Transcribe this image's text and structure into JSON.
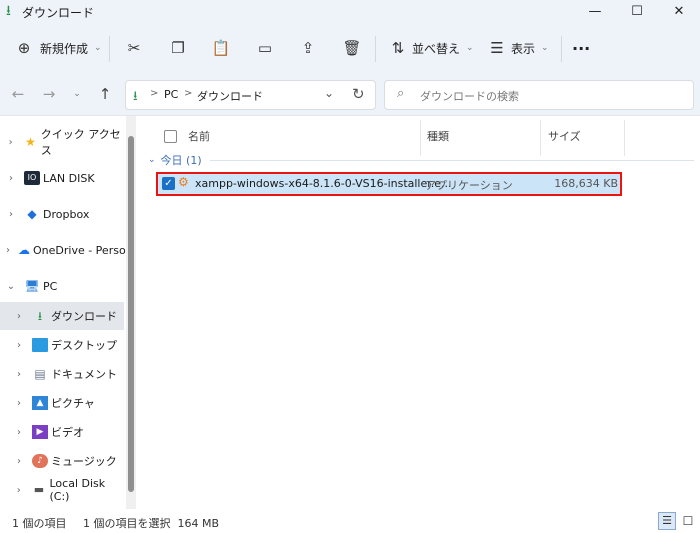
{
  "window": {
    "title": "ダウンロード",
    "minimize_glyph": "—",
    "maximize_glyph": "☐",
    "close_glyph": "✕"
  },
  "toolbar": {
    "new_label": "新規作成",
    "sort_label": "並べ替え",
    "view_label": "表示",
    "more_glyph": "···"
  },
  "address": {
    "segments": [
      "PC",
      "ダウンロード"
    ],
    "separator": ">"
  },
  "search": {
    "placeholder": "ダウンロードの検索"
  },
  "sidebar": {
    "items": [
      {
        "label": "クイック アクセス",
        "icon": "star-icon"
      },
      {
        "label": "LAN DISK",
        "icon": "lan-disk-icon"
      },
      {
        "label": "Dropbox",
        "icon": "dropbox-icon"
      },
      {
        "label": "OneDrive - Perso",
        "icon": "onedrive-icon"
      },
      {
        "label": "PC",
        "icon": "pc-icon"
      },
      {
        "label": "ダウンロード",
        "icon": "download-icon"
      },
      {
        "label": "デスクトップ",
        "icon": "desktop-icon"
      },
      {
        "label": "ドキュメント",
        "icon": "document-icon"
      },
      {
        "label": "ピクチャ",
        "icon": "picture-icon"
      },
      {
        "label": "ビデオ",
        "icon": "video-icon"
      },
      {
        "label": "ミュージック",
        "icon": "music-icon"
      },
      {
        "label": "Local Disk (C:)",
        "icon": "drive-icon"
      }
    ]
  },
  "columns": {
    "name": "名前",
    "type": "種類",
    "size": "サイズ"
  },
  "group": {
    "label": "今日 (1)"
  },
  "files": [
    {
      "name": "xampp-windows-x64-8.1.6-0-VS16-installer.e...",
      "type": "アプリケーション",
      "size": "168,634 KB",
      "selected": true
    }
  ],
  "status": {
    "item_count": "1 個の項目",
    "selection": "1 個の項目を選択  164 MB"
  },
  "colors": {
    "accent": "#1a6fc7",
    "selection_bg": "#cce4f7",
    "highlight_border": "#e8160f"
  }
}
